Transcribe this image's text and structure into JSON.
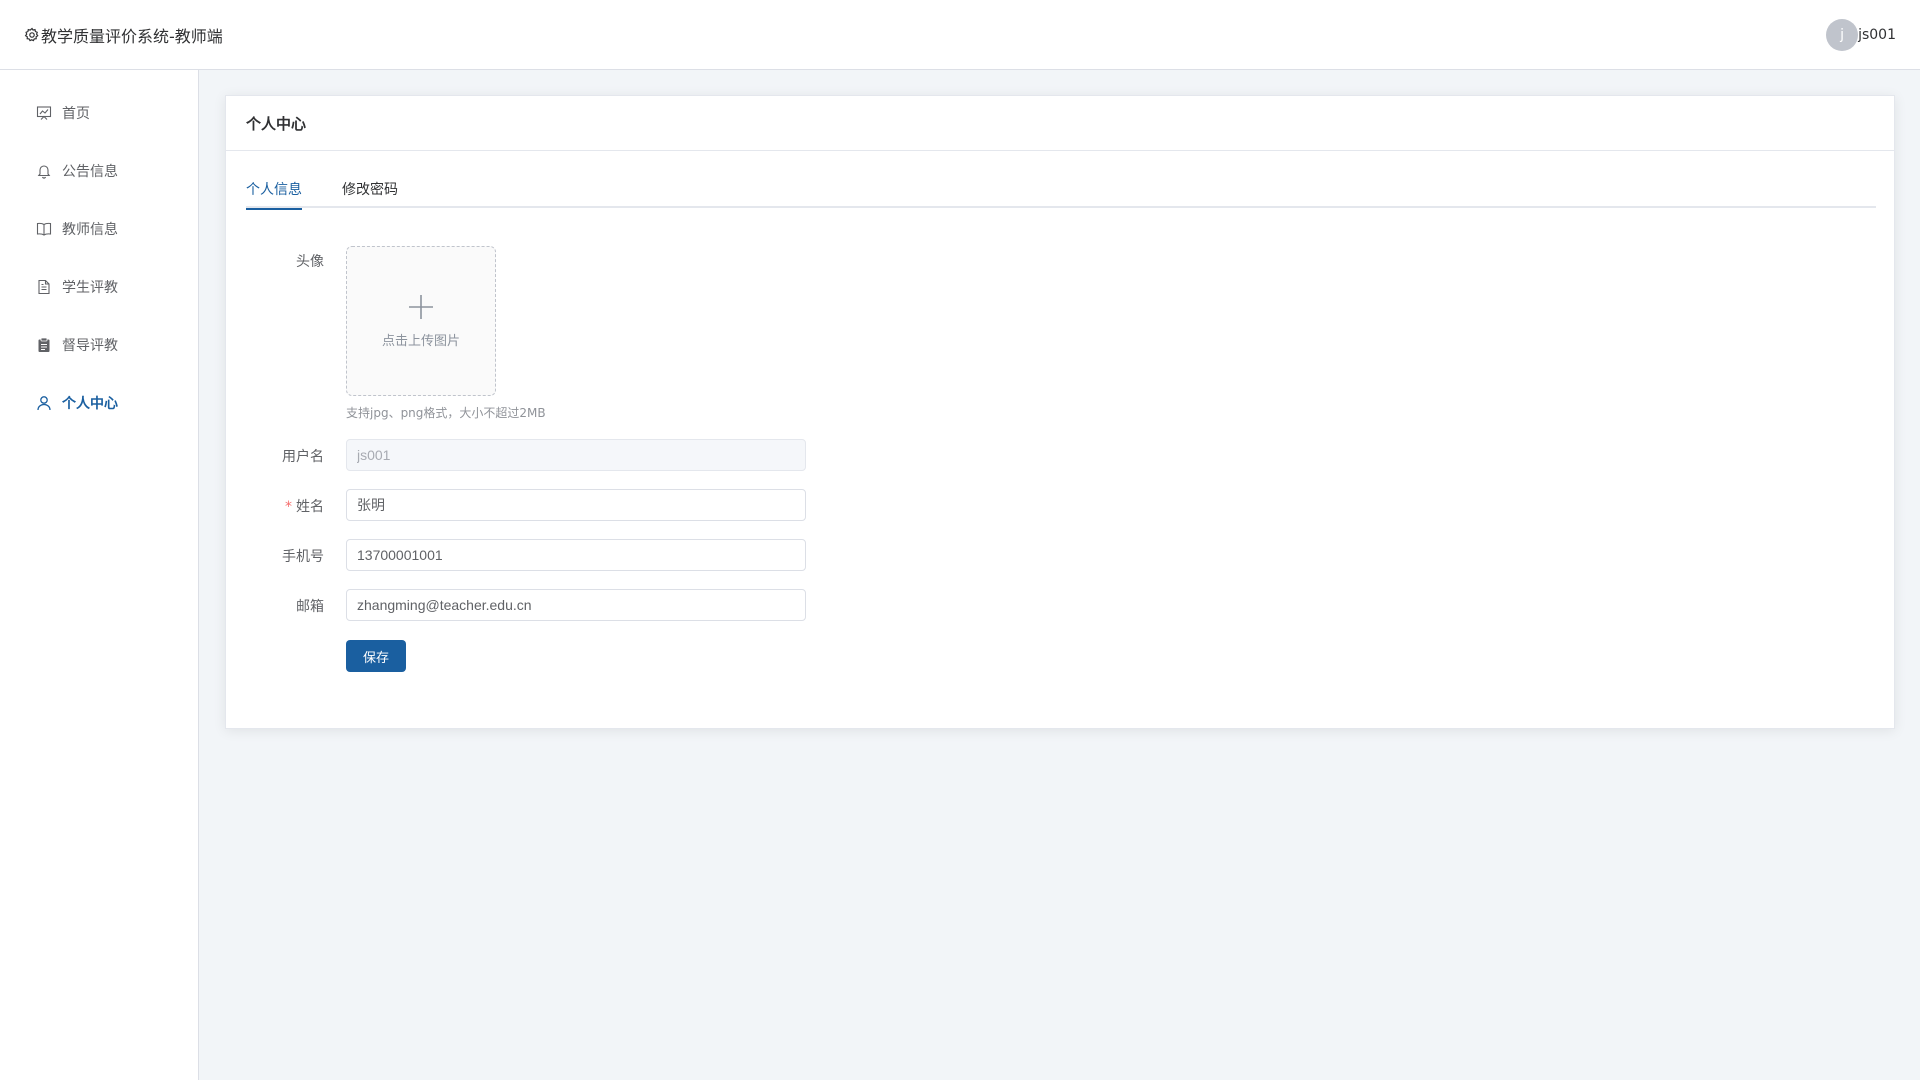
{
  "header": {
    "title": "教学质量评价系统-教师端",
    "user_initial": "j",
    "username": "js001"
  },
  "sidebar": {
    "items": [
      {
        "label": "首页",
        "icon": "dashboard-icon",
        "active": false
      },
      {
        "label": "公告信息",
        "icon": "bell-icon",
        "active": false
      },
      {
        "label": "教师信息",
        "icon": "book-icon",
        "active": false
      },
      {
        "label": "学生评教",
        "icon": "document-icon",
        "active": false
      },
      {
        "label": "督导评教",
        "icon": "clipboard-icon",
        "active": false
      },
      {
        "label": "个人中心",
        "icon": "user-icon",
        "active": true
      }
    ]
  },
  "card": {
    "title": "个人中心",
    "tabs": [
      {
        "label": "个人信息",
        "active": true
      },
      {
        "label": "修改密码",
        "active": false
      }
    ]
  },
  "form": {
    "avatar_label": "头像",
    "upload_text": "点击上传图片",
    "upload_hint": "支持jpg、png格式，大小不超过2MB",
    "username_label": "用户名",
    "username_value": "js001",
    "name_required_mark": "*",
    "name_label": "姓名",
    "name_value": "张明",
    "phone_label": "手机号",
    "phone_value": "13700001001",
    "email_label": "邮箱",
    "email_value": "zhangming@teacher.edu.cn",
    "save_label": "保存"
  },
  "colors": {
    "accent": "#1a5fa0",
    "background": "#f2f5f8",
    "required": "#f56c6c"
  }
}
